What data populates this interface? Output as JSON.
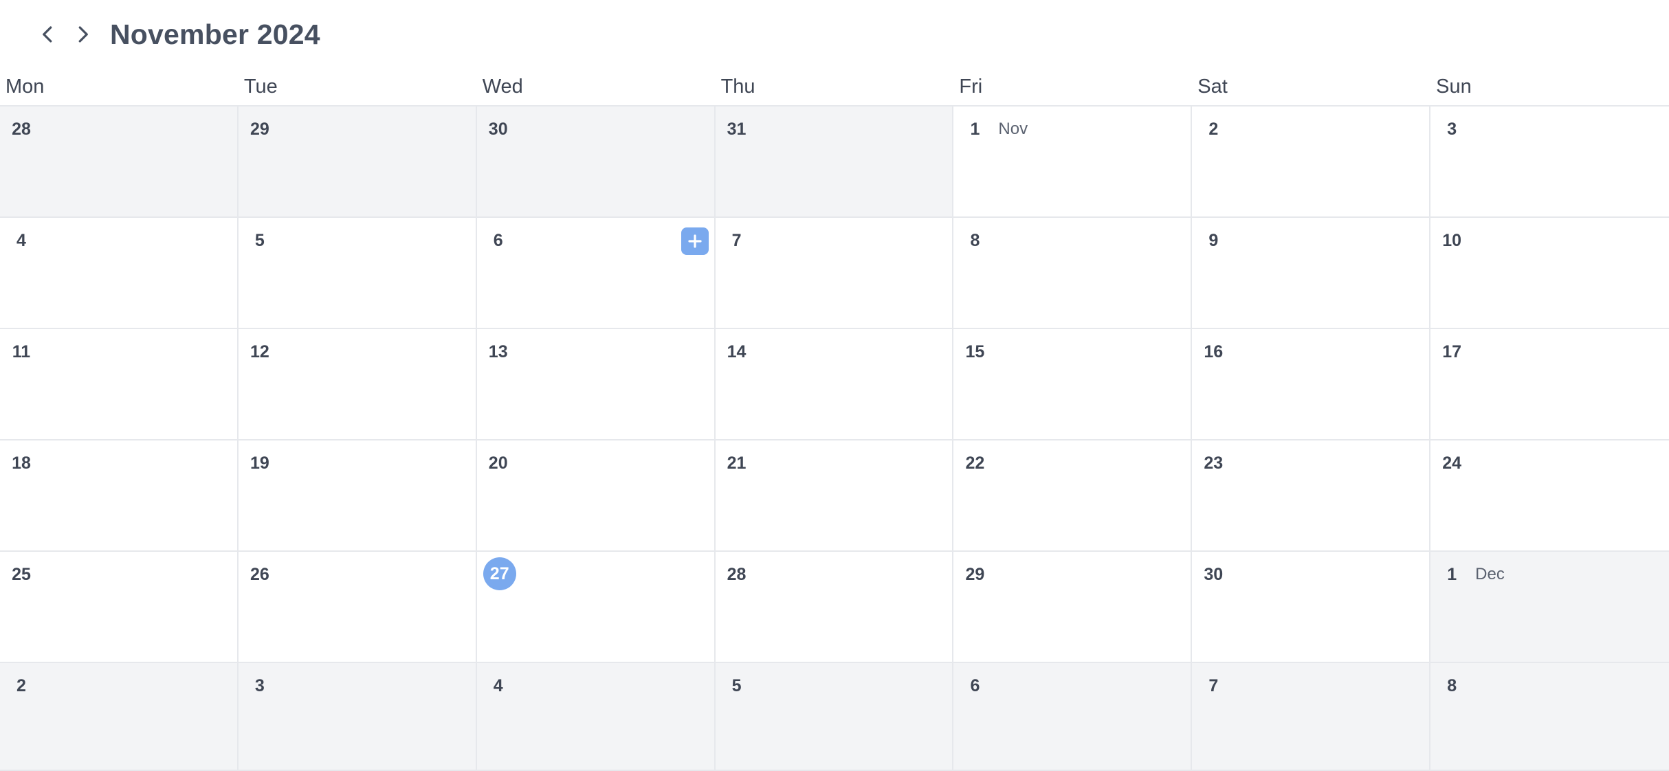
{
  "header": {
    "title": "November 2024",
    "prev_icon": "chevron-left-icon",
    "next_icon": "chevron-right-icon"
  },
  "weekdays": [
    "Mon",
    "Tue",
    "Wed",
    "Thu",
    "Fri",
    "Sat",
    "Sun"
  ],
  "today": "27",
  "colors": {
    "accent": "#7aa9ee",
    "outside_bg": "#f3f4f6",
    "text": "#3f4654",
    "border": "#e6e8ec"
  },
  "weeks": [
    [
      {
        "day": "28",
        "outside": true
      },
      {
        "day": "29",
        "outside": true
      },
      {
        "day": "30",
        "outside": true
      },
      {
        "day": "31",
        "outside": true
      },
      {
        "day": "1",
        "month_label": "Nov"
      },
      {
        "day": "2"
      },
      {
        "day": "3"
      }
    ],
    [
      {
        "day": "4"
      },
      {
        "day": "5"
      },
      {
        "day": "6",
        "add_button": true
      },
      {
        "day": "7"
      },
      {
        "day": "8"
      },
      {
        "day": "9"
      },
      {
        "day": "10"
      }
    ],
    [
      {
        "day": "11"
      },
      {
        "day": "12"
      },
      {
        "day": "13"
      },
      {
        "day": "14"
      },
      {
        "day": "15"
      },
      {
        "day": "16"
      },
      {
        "day": "17"
      }
    ],
    [
      {
        "day": "18"
      },
      {
        "day": "19"
      },
      {
        "day": "20"
      },
      {
        "day": "21"
      },
      {
        "day": "22"
      },
      {
        "day": "23"
      },
      {
        "day": "24"
      }
    ],
    [
      {
        "day": "25"
      },
      {
        "day": "26"
      },
      {
        "day": "27",
        "today": true
      },
      {
        "day": "28"
      },
      {
        "day": "29"
      },
      {
        "day": "30"
      },
      {
        "day": "1",
        "outside": true,
        "month_label": "Dec"
      }
    ],
    [
      {
        "day": "2",
        "outside": true
      },
      {
        "day": "3",
        "outside": true
      },
      {
        "day": "4",
        "outside": true
      },
      {
        "day": "5",
        "outside": true
      },
      {
        "day": "6",
        "outside": true
      },
      {
        "day": "7",
        "outside": true
      },
      {
        "day": "8",
        "outside": true
      }
    ]
  ]
}
